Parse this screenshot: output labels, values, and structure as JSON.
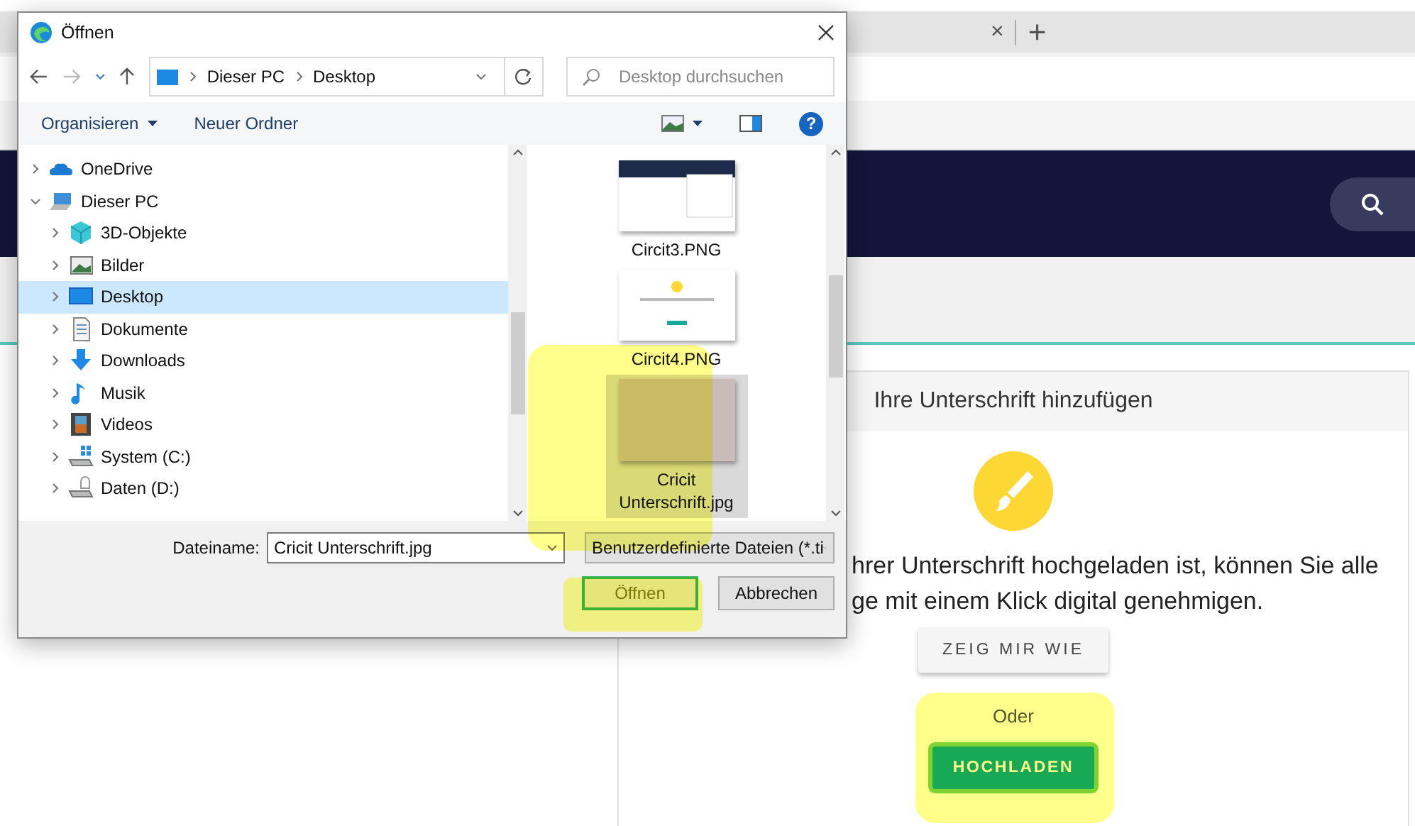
{
  "browser": {
    "tab_close": "×",
    "new_tab": "+"
  },
  "card": {
    "title": "Ihre Unterschrift hinzufügen",
    "text_lines": [
      "hrer Unterschrift hochgeladen ist, können Sie alle",
      "ge mit einem Klick digital genehmigen."
    ],
    "help_button": "ZEIG MIR WIE",
    "or_label": "Oder",
    "upload_button": "HOCHLADEN"
  },
  "dialog": {
    "title": "Öffnen",
    "breadcrumb": [
      "Dieser PC",
      "Desktop"
    ],
    "search": {
      "placeholder": "Desktop durchsuchen"
    },
    "toolbar": {
      "organize": "Organisieren",
      "new_folder": "Neuer Ordner",
      "help": "?"
    },
    "tree": [
      {
        "label": "OneDrive",
        "expanded": false,
        "selected": false
      },
      {
        "label": "Dieser PC",
        "expanded": true,
        "selected": false,
        "children": [
          {
            "label": "3D-Objekte",
            "expanded": false,
            "selected": false
          },
          {
            "label": "Bilder",
            "expanded": false,
            "selected": false
          },
          {
            "label": "Desktop",
            "expanded": false,
            "selected": true
          },
          {
            "label": "Dokumente",
            "expanded": false,
            "selected": false
          },
          {
            "label": "Downloads",
            "expanded": false,
            "selected": false
          },
          {
            "label": "Musik",
            "expanded": false,
            "selected": false
          },
          {
            "label": "Videos",
            "expanded": false,
            "selected": false
          },
          {
            "label": "System (C:)",
            "expanded": false,
            "selected": false
          },
          {
            "label": "Daten (D:)",
            "expanded": false,
            "selected": false
          }
        ]
      }
    ],
    "files": [
      {
        "name": "Circit3.PNG",
        "kind": "screenshot",
        "selected": false
      },
      {
        "name": "Circit4.PNG",
        "kind": "screenshot",
        "selected": false
      },
      {
        "name": "Cricit Unterschrift.jpg",
        "kind": "photo",
        "selected": true
      }
    ],
    "filename_label": "Dateiname:",
    "filename": "Cricit Unterschrift.jpg",
    "filetype": "Benutzerdefinierte Dateien (*.ti",
    "open_button": "Öffnen",
    "cancel_button": "Abbrechen"
  }
}
